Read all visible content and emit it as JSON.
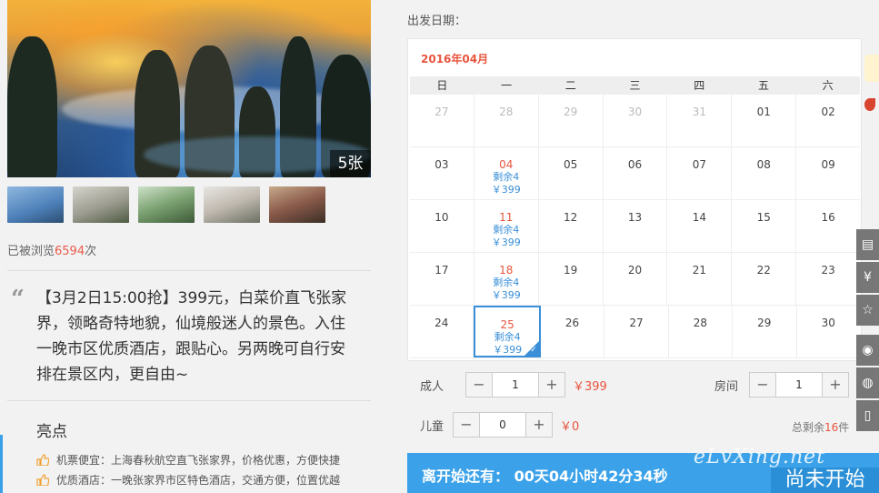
{
  "gallery": {
    "photo_count": "5张"
  },
  "views": {
    "prefix": "已被浏览",
    "count": "6594",
    "suffix": "次"
  },
  "description": "【3月2日15:00抢】399元，白菜价直飞张家界，领略奇特地貌，仙境般迷人的景色。入住一晚市区优质酒店，跟贴心。另两晚可自行安排在景区内，更自由~",
  "highlights": {
    "title": "亮点",
    "items": [
      "机票便宜：上海春秋航空直飞张家界，价格优惠，方便快捷",
      "优质酒店：一晚张家界市区特色酒店，交通方便，位置优越"
    ]
  },
  "calendar": {
    "label": "出发日期：",
    "month": "2016年04月",
    "weekdays": [
      "日",
      "一",
      "二",
      "三",
      "四",
      "五",
      "六"
    ],
    "rows": [
      [
        {
          "d": "27",
          "o": true
        },
        {
          "d": "28",
          "o": true
        },
        {
          "d": "29",
          "o": true
        },
        {
          "d": "30",
          "o": true
        },
        {
          "d": "31",
          "o": true
        },
        {
          "d": "01"
        },
        {
          "d": "02"
        }
      ],
      [
        {
          "d": "03"
        },
        {
          "d": "04",
          "r": "剩余4",
          "p": "￥399"
        },
        {
          "d": "05"
        },
        {
          "d": "06"
        },
        {
          "d": "07"
        },
        {
          "d": "08"
        },
        {
          "d": "09"
        }
      ],
      [
        {
          "d": "10"
        },
        {
          "d": "11",
          "r": "剩余4",
          "p": "￥399"
        },
        {
          "d": "12"
        },
        {
          "d": "13"
        },
        {
          "d": "14"
        },
        {
          "d": "15"
        },
        {
          "d": "16"
        }
      ],
      [
        {
          "d": "17"
        },
        {
          "d": "18",
          "r": "剩余4",
          "p": "￥399"
        },
        {
          "d": "19"
        },
        {
          "d": "20"
        },
        {
          "d": "21"
        },
        {
          "d": "22"
        },
        {
          "d": "23"
        }
      ],
      [
        {
          "d": "24"
        },
        {
          "d": "25",
          "r": "剩余4",
          "p": "￥399",
          "sel": true
        },
        {
          "d": "26"
        },
        {
          "d": "27"
        },
        {
          "d": "28"
        },
        {
          "d": "29"
        },
        {
          "d": "30"
        }
      ]
    ]
  },
  "booking": {
    "adult_label": "成人",
    "adult_value": "1",
    "adult_price": "￥399",
    "room_label": "房间",
    "room_value": "1",
    "child_label": "儿童",
    "child_value": "0",
    "child_price": "￥0",
    "remain_prefix": "总剩余",
    "remain_count": "16",
    "remain_suffix": "件",
    "minus": "−",
    "plus": "+"
  },
  "countdown": {
    "text": "离开始还有： 00天04小时42分34秒",
    "button": "尚未开始"
  },
  "watermark": "eLvXing.net",
  "side_icons": [
    "list-icon",
    "yen-icon",
    "star-icon",
    "weibo-icon",
    "wechat-icon",
    "mobile-icon"
  ]
}
